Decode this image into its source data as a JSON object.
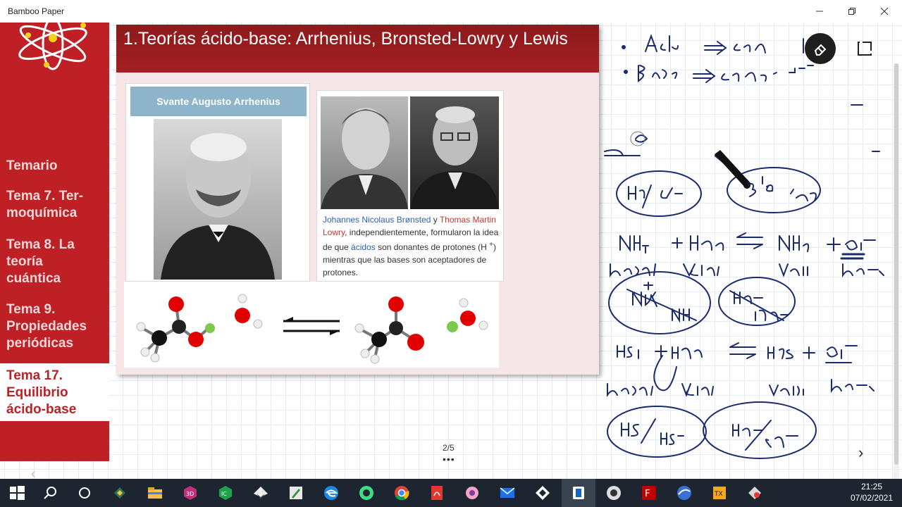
{
  "app": {
    "title": "Bamboo Paper"
  },
  "sidebar": {
    "items": [
      {
        "label": "Temario"
      },
      {
        "label": "Tema 7. Ter-\nmoquímica"
      },
      {
        "label": "Tema 8. La\nteoría\ncuántica"
      },
      {
        "label": "Tema 9.\nPropiedades\nperiódicas"
      }
    ],
    "active": {
      "label": "Tema 17.\nEquilibrio\nácido-base"
    },
    "prev_arrow": "‹"
  },
  "slide": {
    "title": "1.Teorías ácido-base: Arrhenius, Bronsted-Lowry y Lewis",
    "card1_banner": "Svante Augusto Arrhenius",
    "caption": {
      "name1": "Johannes Nicolaus Brønsted",
      "y": " y ",
      "name2": "Thomas Martin Lowry",
      "text1": ", independientemente, formularon la idea de que ",
      "acidos": "ácidos",
      "text2": " son donantes de protones (H ",
      "plus": "+",
      "text3": ") mientras que las bases son aceptadores de protones."
    }
  },
  "pager": {
    "page": "2/5",
    "dots": "•••"
  },
  "nav": {
    "next_arrow": "›"
  },
  "taskbar": {
    "time": "21:25",
    "date": "07/02/2021",
    "icons": [
      "windows-start-icon",
      "search-icon",
      "cortana-icon",
      "mail-app-icon",
      "file-explorer-icon",
      "app-3d-icon",
      "app-ice-icon",
      "app-inkscape-icon",
      "app-pen-icon",
      "edge-icon",
      "android-studio-icon",
      "chrome-icon",
      "acrobat-icon",
      "paint-icon",
      "mail-icon",
      "cube-icon",
      "bamboo-paper-icon",
      "obs-icon",
      "filezilla-icon",
      "browser-icon",
      "xampp-icon",
      "app-last-icon"
    ]
  },
  "colors": {
    "brand_red": "#be2026",
    "header_red": "#8d1a1c",
    "banner_blue": "#8eb4cc",
    "ink_blue": "#1a2a6c"
  }
}
